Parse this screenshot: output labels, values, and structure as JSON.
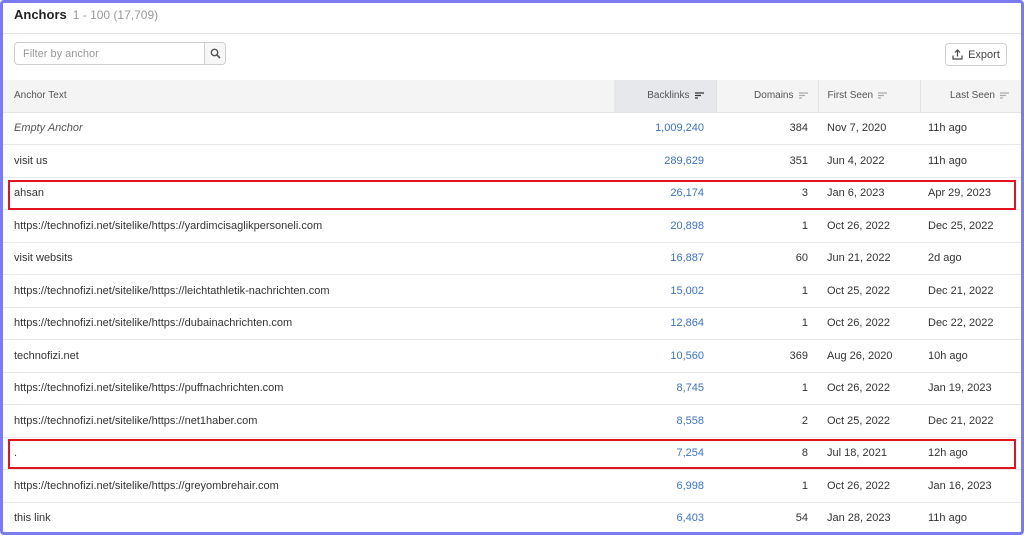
{
  "header": {
    "title": "Anchors",
    "range": "1 - 100 (17,709)"
  },
  "filter": {
    "placeholder": "Filter by anchor"
  },
  "toolbar": {
    "export_label": "Export"
  },
  "columns": {
    "anchor": "Anchor Text",
    "backlinks": "Backlinks",
    "domains": "Domains",
    "first_seen": "First Seen",
    "last_seen": "Last Seen"
  },
  "rows": [
    {
      "anchor": "Empty Anchor",
      "backlinks": "1,009,240",
      "domains": "384",
      "first_seen": "Nov 7, 2020",
      "last_seen": "11h ago"
    },
    {
      "anchor": "visit us",
      "backlinks": "289,629",
      "domains": "351",
      "first_seen": "Jun 4, 2022",
      "last_seen": "11h ago"
    },
    {
      "anchor": "ahsan",
      "backlinks": "26,174",
      "domains": "3",
      "first_seen": "Jan 6, 2023",
      "last_seen": "Apr 29, 2023"
    },
    {
      "anchor": "https://technofizi.net/sitelike/https://yardimcisaglikpersoneli.com",
      "backlinks": "20,898",
      "domains": "1",
      "first_seen": "Oct 26, 2022",
      "last_seen": "Dec 25, 2022"
    },
    {
      "anchor": "visit websits",
      "backlinks": "16,887",
      "domains": "60",
      "first_seen": "Jun 21, 2022",
      "last_seen": "2d ago"
    },
    {
      "anchor": "https://technofizi.net/sitelike/https://leichtathletik-nachrichten.com",
      "backlinks": "15,002",
      "domains": "1",
      "first_seen": "Oct 25, 2022",
      "last_seen": "Dec 21, 2022"
    },
    {
      "anchor": "https://technofizi.net/sitelike/https://dubainachrichten.com",
      "backlinks": "12,864",
      "domains": "1",
      "first_seen": "Oct 26, 2022",
      "last_seen": "Dec 22, 2022"
    },
    {
      "anchor": "technofizi.net",
      "backlinks": "10,560",
      "domains": "369",
      "first_seen": "Aug 26, 2020",
      "last_seen": "10h ago"
    },
    {
      "anchor": "https://technofizi.net/sitelike/https://puffnachrichten.com",
      "backlinks": "8,745",
      "domains": "1",
      "first_seen": "Oct 26, 2022",
      "last_seen": "Jan 19, 2023"
    },
    {
      "anchor": "https://technofizi.net/sitelike/https://net1haber.com",
      "backlinks": "8,558",
      "domains": "2",
      "first_seen": "Oct 25, 2022",
      "last_seen": "Dec 21, 2022"
    },
    {
      "anchor": ".",
      "backlinks": "7,254",
      "domains": "8",
      "first_seen": "Jul 18, 2021",
      "last_seen": "12h ago"
    },
    {
      "anchor": "https://technofizi.net/sitelike/https://greyombrehair.com",
      "backlinks": "6,998",
      "domains": "1",
      "first_seen": "Oct 26, 2022",
      "last_seen": "Jan 16, 2023"
    },
    {
      "anchor": "this link",
      "backlinks": "6,403",
      "domains": "54",
      "first_seen": "Jan 28, 2023",
      "last_seen": "11h ago"
    }
  ],
  "icons": {
    "search": "search-icon",
    "export": "upload-icon",
    "sort": "sort-icon"
  },
  "colors": {
    "highlight": "#e0141e",
    "link": "#3b73bf",
    "frame": "#7b7bef"
  }
}
